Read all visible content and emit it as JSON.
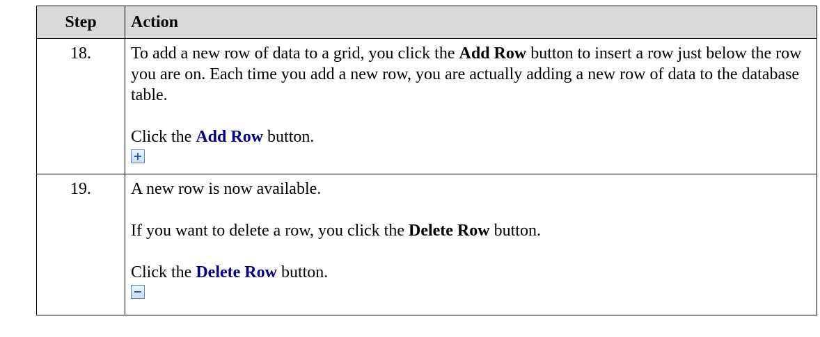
{
  "header": {
    "step": "Step",
    "action": "Action"
  },
  "rows": [
    {
      "step": "18.",
      "p1": {
        "a": "To add a new row of data to a grid, you click the ",
        "bold": "Add Row",
        "b": " button to insert a row just below the row you are on. Each time you add a new row, you are actually adding a new row of data to the database table."
      },
      "p2": {
        "a": "Click the ",
        "bold": "Add Row",
        "b": " button."
      },
      "icon": "add-row-icon"
    },
    {
      "step": "19.",
      "p1": {
        "text": "A new row is now available."
      },
      "p2": {
        "a": "If you want to delete a row, you click the ",
        "bold": "Delete Row",
        "b": " button."
      },
      "p3": {
        "a": "Click the ",
        "bold": "Delete Row",
        "b": " button."
      },
      "icon": "delete-row-icon"
    }
  ]
}
